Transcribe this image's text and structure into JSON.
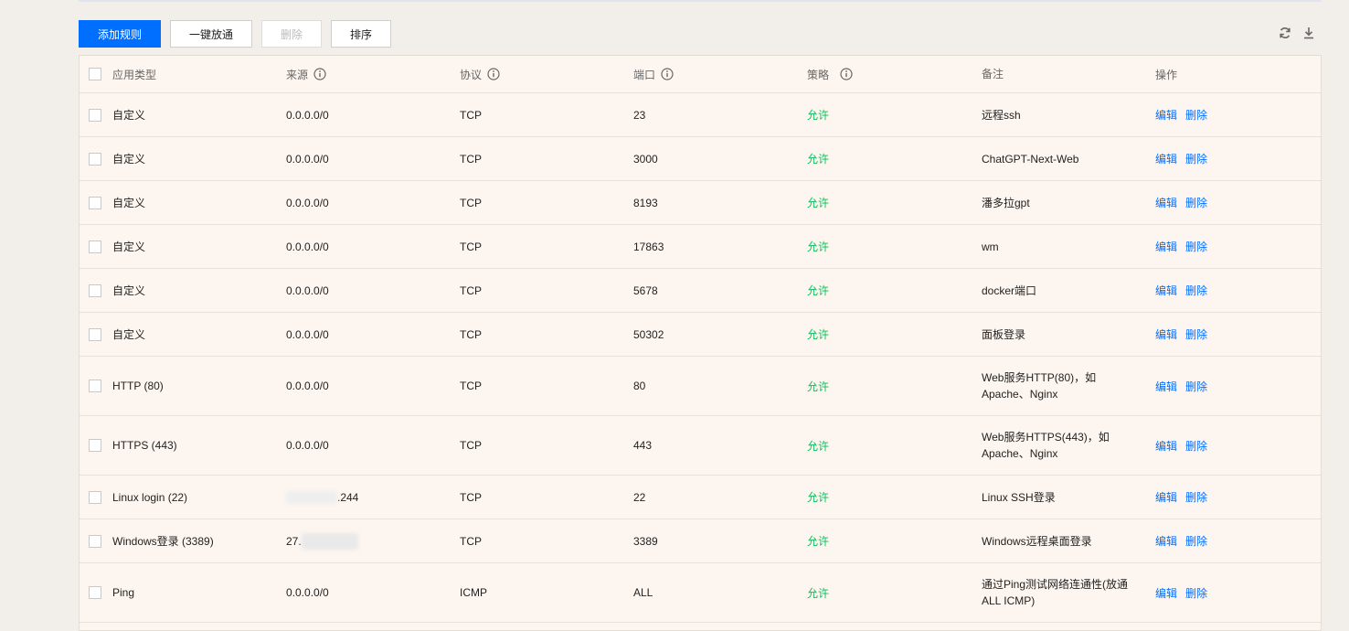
{
  "toolbar": {
    "add_rule": "添加规则",
    "one_click_open": "一键放通",
    "delete": "删除",
    "sort": "排序"
  },
  "icons": {
    "refresh": "refresh-icon",
    "download": "download-icon",
    "info": "info-circle-icon"
  },
  "colors": {
    "accent": "#006eff",
    "allow": "#0abf5b",
    "table_bg": "#fdf6f0"
  },
  "table": {
    "headers": [
      "应用类型",
      "来源",
      "协议",
      "端口",
      "策略",
      "备注",
      "操作"
    ],
    "rows": [
      {
        "type": "自定义",
        "source": "0.0.0.0/0",
        "protocol": "TCP",
        "port": "23",
        "policy": "允许",
        "note": "远程ssh",
        "edit": "编辑",
        "delete": "删除"
      },
      {
        "type": "自定义",
        "source": "0.0.0.0/0",
        "protocol": "TCP",
        "port": "3000",
        "policy": "允许",
        "note": "ChatGPT-Next-Web",
        "edit": "编辑",
        "delete": "删除"
      },
      {
        "type": "自定义",
        "source": "0.0.0.0/0",
        "protocol": "TCP",
        "port": "8193",
        "policy": "允许",
        "note": "潘多拉gpt",
        "edit": "编辑",
        "delete": "删除"
      },
      {
        "type": "自定义",
        "source": "0.0.0.0/0",
        "protocol": "TCP",
        "port": "17863",
        "policy": "允许",
        "note": "wm",
        "edit": "编辑",
        "delete": "删除"
      },
      {
        "type": "自定义",
        "source": "0.0.0.0/0",
        "protocol": "TCP",
        "port": "5678",
        "policy": "允许",
        "note": "docker端口",
        "edit": "编辑",
        "delete": "删除"
      },
      {
        "type": "自定义",
        "source": "0.0.0.0/0",
        "protocol": "TCP",
        "port": "50302",
        "policy": "允许",
        "note": "面板登录",
        "edit": "编辑",
        "delete": "删除"
      },
      {
        "type": "HTTP (80)",
        "source": "0.0.0.0/0",
        "protocol": "TCP",
        "port": "80",
        "policy": "允许",
        "note": "Web服务HTTP(80)，如Apache、Nginx",
        "edit": "编辑",
        "delete": "删除"
      },
      {
        "type": "HTTPS (443)",
        "source": "0.0.0.0/0",
        "protocol": "TCP",
        "port": "443",
        "policy": "允许",
        "note": "Web服务HTTPS(443)，如Apache、Nginx",
        "edit": "编辑",
        "delete": "删除"
      },
      {
        "type": "Linux login (22)",
        "source": ".244",
        "protocol": "TCP",
        "port": "22",
        "policy": "允许",
        "note": "Linux SSH登录",
        "edit": "编辑",
        "delete": "删除"
      },
      {
        "type": "Windows登录 (3389)",
        "source": "27.",
        "protocol": "TCP",
        "port": "3389",
        "policy": "允许",
        "note": "Windows远程桌面登录",
        "edit": "编辑",
        "delete": "删除"
      },
      {
        "type": "Ping",
        "source": "0.0.0.0/0",
        "protocol": "ICMP",
        "port": "ALL",
        "policy": "允许",
        "note": "通过Ping测试网络连通性(放通ALL ICMP)",
        "edit": "编辑",
        "delete": "删除"
      }
    ]
  }
}
